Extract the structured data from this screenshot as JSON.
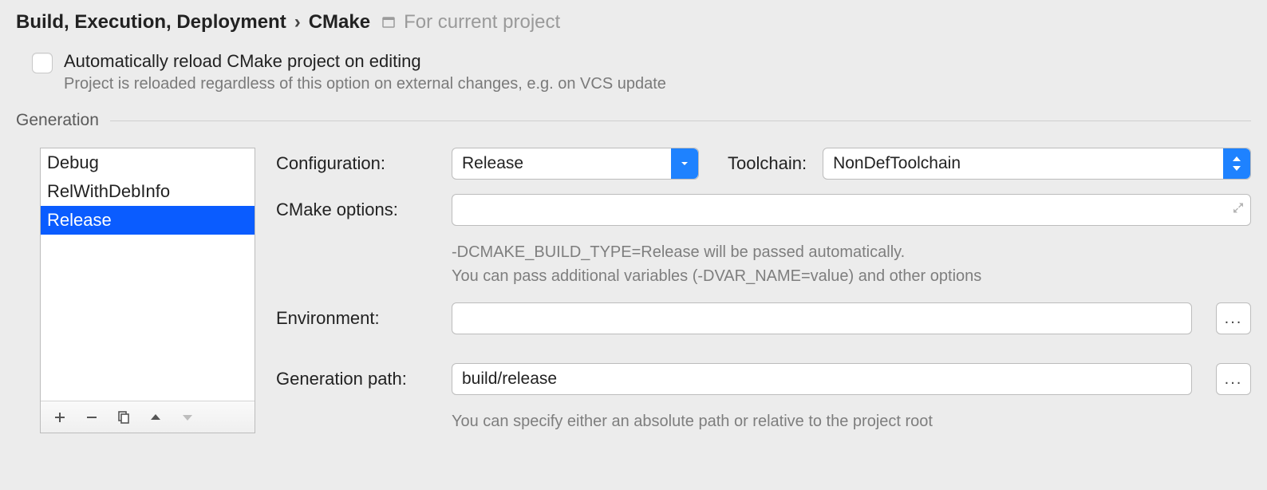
{
  "breadcrumb": {
    "parent": "Build, Execution, Deployment",
    "current": "CMake",
    "scope": "For current project"
  },
  "auto_reload": {
    "label": "Automatically reload CMake project on editing",
    "hint": "Project is reloaded regardless of this option on external changes, e.g. on VCS update"
  },
  "group": {
    "title": "Generation"
  },
  "profiles": {
    "items": [
      "Debug",
      "RelWithDebInfo",
      "Release"
    ],
    "selected_index": 2
  },
  "form": {
    "configuration": {
      "label": "Configuration:",
      "value": "Release"
    },
    "toolchain": {
      "label": "Toolchain:",
      "value": "NonDefToolchain"
    },
    "cmake_options": {
      "label": "CMake options:",
      "value": "",
      "hint1": "-DCMAKE_BUILD_TYPE=Release will be passed automatically.",
      "hint2": "You can pass additional variables (-DVAR_NAME=value) and other options"
    },
    "environment": {
      "label": "Environment:",
      "value": ""
    },
    "generation_path": {
      "label": "Generation path:",
      "value": "build/release",
      "hint": "You can specify either an absolute path or relative to the project root"
    }
  }
}
